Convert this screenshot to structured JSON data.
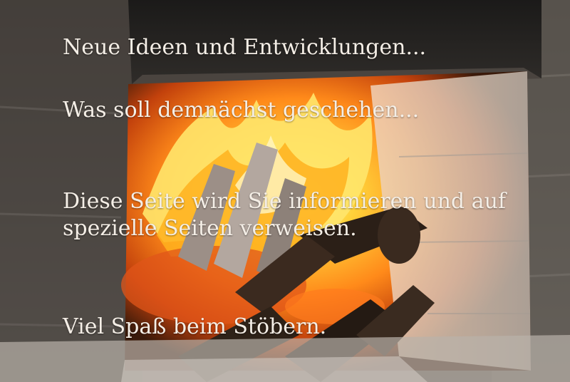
{
  "photo": {
    "subject": "fireplace-with-burning-logs-icon",
    "colors": {
      "brick_dark": "#2a2622",
      "brick_light": "#8c8780",
      "firebox_wall": "#d8cfc6",
      "fire_core": "#ffd23a",
      "fire_mid": "#ff8a1a",
      "ember": "#c2410c",
      "log": "#2b1f17"
    }
  },
  "text": {
    "line1": "Neue Ideen und Entwicklungen...",
    "line2": "Was soll demnächst geschehen...",
    "line3": "Diese Seite wird Sie informieren und auf",
    "line4": "spezielle Seiten verweisen.",
    "line5": "Viel Spaß beim Stöbern."
  }
}
